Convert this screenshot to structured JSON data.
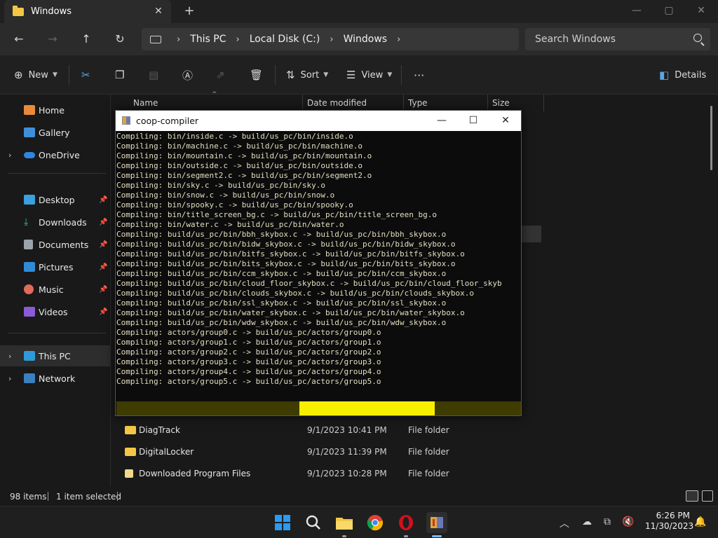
{
  "explorer": {
    "tab_title": "Windows",
    "tab_close": "✕",
    "new_tab": "+",
    "window_controls": {
      "minimize": "—",
      "maximize": "▢",
      "close": "✕"
    },
    "nav": {
      "back": "←",
      "forward": "→",
      "up": "↑",
      "refresh": "↻"
    },
    "breadcrumb": [
      "This PC",
      "Local Disk (C:)",
      "Windows"
    ],
    "breadcrumb_sep": "›",
    "search_placeholder": "Search Windows",
    "toolbar": {
      "new_label": "New",
      "sort_label": "Sort",
      "view_label": "View",
      "more_label": "···",
      "details_label": "Details"
    },
    "sidebar": {
      "home": "Home",
      "gallery": "Gallery",
      "onedrive": "OneDrive",
      "desktop": "Desktop",
      "downloads": "Downloads",
      "documents": "Documents",
      "pictures": "Pictures",
      "music": "Music",
      "videos": "Videos",
      "this_pc": "This PC",
      "network": "Network"
    },
    "columns": {
      "name": "Name",
      "date_modified": "Date modified",
      "type": "Type",
      "size": "Size"
    },
    "rows": [
      {
        "name": "DiagTrack",
        "date": "9/1/2023 10:41 PM",
        "type": "File folder"
      },
      {
        "name": "DigitalLocker",
        "date": "9/1/2023 11:39 PM",
        "type": "File folder"
      },
      {
        "name": "Downloaded Program Files",
        "date": "9/1/2023 10:28 PM",
        "type": "File folder"
      }
    ],
    "status": {
      "item_count": "98 items",
      "selected": "1 item selected"
    }
  },
  "console": {
    "title": "coop-compiler",
    "controls": {
      "minimize": "—",
      "maximize": "☐",
      "close": "✕"
    },
    "lines": [
      "Compiling: bin/inside.c -> build/us_pc/bin/inside.o",
      "Compiling: bin/machine.c -> build/us_pc/bin/machine.o",
      "Compiling: bin/mountain.c -> build/us_pc/bin/mountain.o",
      "Compiling: bin/outside.c -> build/us_pc/bin/outside.o",
      "Compiling: bin/segment2.c -> build/us_pc/bin/segment2.o",
      "Compiling: bin/sky.c -> build/us_pc/bin/sky.o",
      "Compiling: bin/snow.c -> build/us_pc/bin/snow.o",
      "Compiling: bin/spooky.c -> build/us_pc/bin/spooky.o",
      "Compiling: bin/title_screen_bg.c -> build/us_pc/bin/title_screen_bg.o",
      "Compiling: bin/water.c -> build/us_pc/bin/water.o",
      "Compiling: build/us_pc/bin/bbh_skybox.c -> build/us_pc/bin/bbh_skybox.o",
      "Compiling: build/us_pc/bin/bidw_skybox.c -> build/us_pc/bin/bidw_skybox.o",
      "Compiling: build/us_pc/bin/bitfs_skybox.c -> build/us_pc/bin/bitfs_skybox.o",
      "Compiling: build/us_pc/bin/bits_skybox.c -> build/us_pc/bin/bits_skybox.o",
      "Compiling: build/us_pc/bin/ccm_skybox.c -> build/us_pc/bin/ccm_skybox.o",
      "Compiling: build/us_pc/bin/cloud_floor_skybox.c -> build/us_pc/bin/cloud_floor_skyb",
      "Compiling: build/us_pc/bin/clouds_skybox.c -> build/us_pc/bin/clouds_skybox.o",
      "Compiling: build/us_pc/bin/ssl_skybox.c -> build/us_pc/bin/ssl_skybox.o",
      "Compiling: build/us_pc/bin/water_skybox.c -> build/us_pc/bin/water_skybox.o",
      "Compiling: build/us_pc/bin/wdw_skybox.c -> build/us_pc/bin/wdw_skybox.o",
      "Compiling: actors/group0.c -> build/us_pc/actors/group0.o",
      "Compiling: actors/group1.c -> build/us_pc/actors/group1.o",
      "Compiling: actors/group2.c -> build/us_pc/actors/group2.o",
      "Compiling: actors/group3.c -> build/us_pc/actors/group3.o",
      "Compiling: actors/group4.c -> build/us_pc/actors/group4.o",
      "Compiling: actors/group5.c -> build/us_pc/actors/group5.o"
    ],
    "progress": {
      "start_fraction": 0.453,
      "end_fraction": 0.788
    },
    "colors": {
      "progress_track": "#3f3c00",
      "progress_fill": "#f7ef00",
      "text": "#e2ddc0"
    }
  },
  "taskbar": {
    "time": "6:26 PM",
    "date": "11/30/2023",
    "apps": [
      "start-icon",
      "search-icon",
      "file-explorer-icon",
      "chrome-icon",
      "opera-icon",
      "coop-compiler-icon"
    ]
  }
}
